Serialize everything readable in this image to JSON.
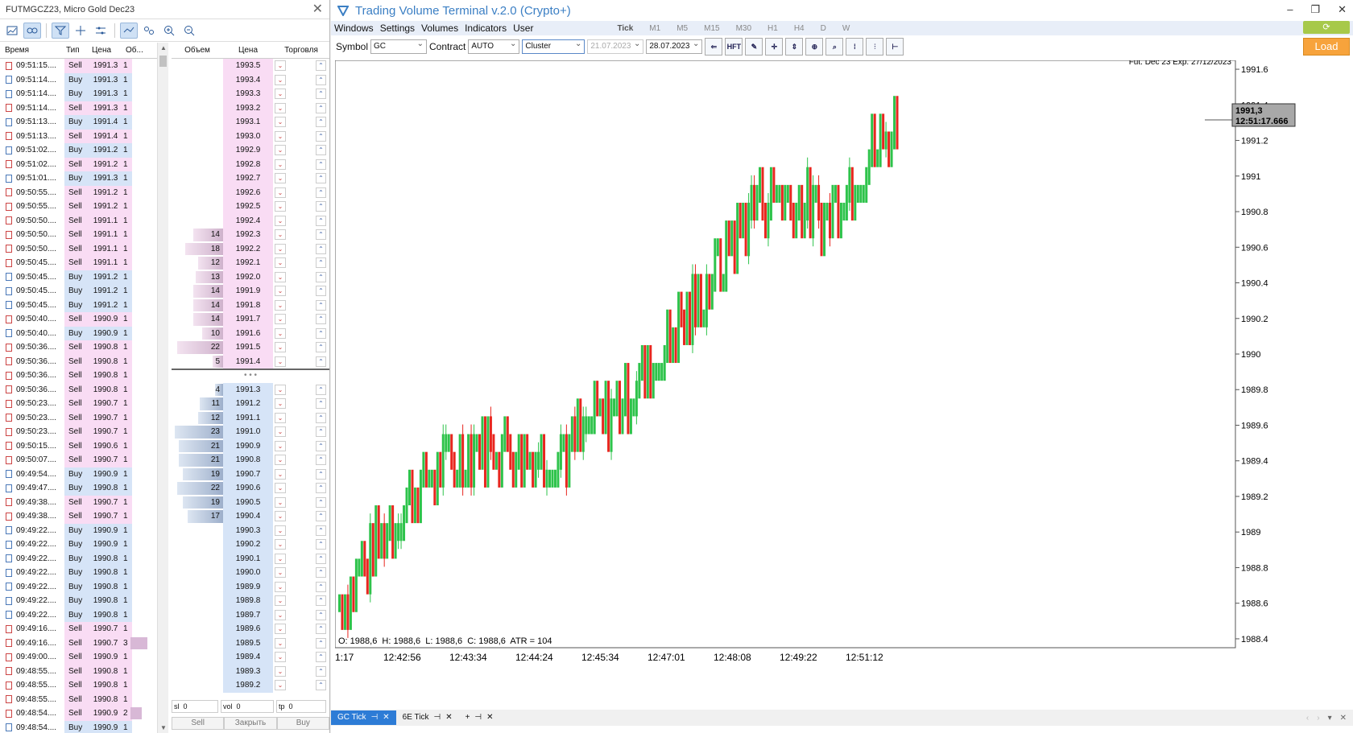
{
  "left_panel": {
    "title": "FUTMGCZ23, Micro Gold Dec23",
    "trade_headers": [
      "Время",
      "Тип",
      "Цена",
      "Об..."
    ],
    "trades": [
      {
        "time": "09:51:15....",
        "type": "Sell",
        "price": "1991.3",
        "vol": "1"
      },
      {
        "time": "09:51:14....",
        "type": "Buy",
        "price": "1991.3",
        "vol": "1"
      },
      {
        "time": "09:51:14....",
        "type": "Buy",
        "price": "1991.3",
        "vol": "1"
      },
      {
        "time": "09:51:14....",
        "type": "Sell",
        "price": "1991.3",
        "vol": "1"
      },
      {
        "time": "09:51:13....",
        "type": "Buy",
        "price": "1991.4",
        "vol": "1"
      },
      {
        "time": "09:51:13....",
        "type": "Sell",
        "price": "1991.4",
        "vol": "1"
      },
      {
        "time": "09:51:02....",
        "type": "Buy",
        "price": "1991.2",
        "vol": "1"
      },
      {
        "time": "09:51:02....",
        "type": "Sell",
        "price": "1991.2",
        "vol": "1"
      },
      {
        "time": "09:51:01....",
        "type": "Buy",
        "price": "1991.3",
        "vol": "1"
      },
      {
        "time": "09:50:55....",
        "type": "Sell",
        "price": "1991.2",
        "vol": "1"
      },
      {
        "time": "09:50:55....",
        "type": "Sell",
        "price": "1991.2",
        "vol": "1"
      },
      {
        "time": "09:50:50....",
        "type": "Sell",
        "price": "1991.1",
        "vol": "1"
      },
      {
        "time": "09:50:50....",
        "type": "Sell",
        "price": "1991.1",
        "vol": "1"
      },
      {
        "time": "09:50:50....",
        "type": "Sell",
        "price": "1991.1",
        "vol": "1"
      },
      {
        "time": "09:50:45....",
        "type": "Sell",
        "price": "1991.1",
        "vol": "1"
      },
      {
        "time": "09:50:45....",
        "type": "Buy",
        "price": "1991.2",
        "vol": "1"
      },
      {
        "time": "09:50:45....",
        "type": "Buy",
        "price": "1991.2",
        "vol": "1"
      },
      {
        "time": "09:50:45....",
        "type": "Buy",
        "price": "1991.2",
        "vol": "1"
      },
      {
        "time": "09:50:40....",
        "type": "Sell",
        "price": "1990.9",
        "vol": "1"
      },
      {
        "time": "09:50:40....",
        "type": "Buy",
        "price": "1990.9",
        "vol": "1"
      },
      {
        "time": "09:50:36....",
        "type": "Sell",
        "price": "1990.8",
        "vol": "1"
      },
      {
        "time": "09:50:36....",
        "type": "Sell",
        "price": "1990.8",
        "vol": "1"
      },
      {
        "time": "09:50:36....",
        "type": "Sell",
        "price": "1990.8",
        "vol": "1"
      },
      {
        "time": "09:50:36....",
        "type": "Sell",
        "price": "1990.8",
        "vol": "1"
      },
      {
        "time": "09:50:23....",
        "type": "Sell",
        "price": "1990.7",
        "vol": "1"
      },
      {
        "time": "09:50:23....",
        "type": "Sell",
        "price": "1990.7",
        "vol": "1"
      },
      {
        "time": "09:50:23....",
        "type": "Sell",
        "price": "1990.7",
        "vol": "1"
      },
      {
        "time": "09:50:15....",
        "type": "Sell",
        "price": "1990.6",
        "vol": "1"
      },
      {
        "time": "09:50:07....",
        "type": "Sell",
        "price": "1990.7",
        "vol": "1"
      },
      {
        "time": "09:49:54....",
        "type": "Buy",
        "price": "1990.9",
        "vol": "1"
      },
      {
        "time": "09:49:47....",
        "type": "Buy",
        "price": "1990.8",
        "vol": "1"
      },
      {
        "time": "09:49:38....",
        "type": "Sell",
        "price": "1990.7",
        "vol": "1"
      },
      {
        "time": "09:49:38....",
        "type": "Sell",
        "price": "1990.7",
        "vol": "1"
      },
      {
        "time": "09:49:22....",
        "type": "Buy",
        "price": "1990.9",
        "vol": "1"
      },
      {
        "time": "09:49:22....",
        "type": "Buy",
        "price": "1990.9",
        "vol": "1"
      },
      {
        "time": "09:49:22....",
        "type": "Buy",
        "price": "1990.8",
        "vol": "1"
      },
      {
        "time": "09:49:22....",
        "type": "Buy",
        "price": "1990.8",
        "vol": "1"
      },
      {
        "time": "09:49:22....",
        "type": "Buy",
        "price": "1990.8",
        "vol": "1"
      },
      {
        "time": "09:49:22....",
        "type": "Buy",
        "price": "1990.8",
        "vol": "1"
      },
      {
        "time": "09:49:22....",
        "type": "Buy",
        "price": "1990.8",
        "vol": "1"
      },
      {
        "time": "09:49:16....",
        "type": "Sell",
        "price": "1990.7",
        "vol": "1"
      },
      {
        "time": "09:49:16....",
        "type": "Sell",
        "price": "1990.7",
        "vol": "3"
      },
      {
        "time": "09:49:00....",
        "type": "Sell",
        "price": "1990.9",
        "vol": "1"
      },
      {
        "time": "09:48:55....",
        "type": "Sell",
        "price": "1990.8",
        "vol": "1"
      },
      {
        "time": "09:48:55....",
        "type": "Sell",
        "price": "1990.8",
        "vol": "1"
      },
      {
        "time": "09:48:55....",
        "type": "Sell",
        "price": "1990.8",
        "vol": "1"
      },
      {
        "time": "09:48:54....",
        "type": "Sell",
        "price": "1990.9",
        "vol": "2"
      },
      {
        "time": "09:48:54....",
        "type": "Buy",
        "price": "1990.9",
        "vol": "1"
      }
    ],
    "dom_headers": [
      "Объем",
      "Цена",
      "Торговля"
    ],
    "asks": [
      {
        "price": "1993.5",
        "vol": ""
      },
      {
        "price": "1993.4",
        "vol": ""
      },
      {
        "price": "1993.3",
        "vol": ""
      },
      {
        "price": "1993.2",
        "vol": ""
      },
      {
        "price": "1993.1",
        "vol": ""
      },
      {
        "price": "1993.0",
        "vol": ""
      },
      {
        "price": "1992.9",
        "vol": ""
      },
      {
        "price": "1992.8",
        "vol": ""
      },
      {
        "price": "1992.7",
        "vol": ""
      },
      {
        "price": "1992.6",
        "vol": ""
      },
      {
        "price": "1992.5",
        "vol": ""
      },
      {
        "price": "1992.4",
        "vol": ""
      },
      {
        "price": "1992.3",
        "vol": "14"
      },
      {
        "price": "1992.2",
        "vol": "18"
      },
      {
        "price": "1992.1",
        "vol": "12"
      },
      {
        "price": "1992.0",
        "vol": "13"
      },
      {
        "price": "1991.9",
        "vol": "14"
      },
      {
        "price": "1991.8",
        "vol": "14"
      },
      {
        "price": "1991.7",
        "vol": "14"
      },
      {
        "price": "1991.6",
        "vol": "10"
      },
      {
        "price": "1991.5",
        "vol": "22"
      },
      {
        "price": "1991.4",
        "vol": "5"
      }
    ],
    "bids": [
      {
        "price": "1991.3",
        "vol": "4"
      },
      {
        "price": "1991.2",
        "vol": "11"
      },
      {
        "price": "1991.1",
        "vol": "12"
      },
      {
        "price": "1991.0",
        "vol": "23"
      },
      {
        "price": "1990.9",
        "vol": "21"
      },
      {
        "price": "1990.8",
        "vol": "21"
      },
      {
        "price": "1990.7",
        "vol": "19"
      },
      {
        "price": "1990.6",
        "vol": "22"
      },
      {
        "price": "1990.5",
        "vol": "19"
      },
      {
        "price": "1990.4",
        "vol": "17"
      },
      {
        "price": "1990.3",
        "vol": ""
      },
      {
        "price": "1990.2",
        "vol": ""
      },
      {
        "price": "1990.1",
        "vol": ""
      },
      {
        "price": "1990.0",
        "vol": ""
      },
      {
        "price": "1989.9",
        "vol": ""
      },
      {
        "price": "1989.8",
        "vol": ""
      },
      {
        "price": "1989.7",
        "vol": ""
      },
      {
        "price": "1989.6",
        "vol": ""
      },
      {
        "price": "1989.5",
        "vol": ""
      },
      {
        "price": "1989.4",
        "vol": ""
      },
      {
        "price": "1989.3",
        "vol": ""
      },
      {
        "price": "1989.2",
        "vol": ""
      }
    ],
    "dom_sep": "• • •",
    "controls": {
      "sl_label": "sl",
      "sl_value": "0",
      "vol_label": "vol",
      "vol_value": "0",
      "tp_label": "tp",
      "tp_value": "0"
    },
    "actions": {
      "sell": "Sell",
      "close": "Закрыть",
      "buy": "Buy"
    }
  },
  "window": {
    "title": "Trading Volume Terminal v.2.0 (Crypto+)",
    "min": "–",
    "max": "❐",
    "close": "✕"
  },
  "menu": [
    "Windows",
    "Settings",
    "Volumes",
    "Indicators",
    "User"
  ],
  "timeframes": [
    "Tick",
    "M1",
    "M5",
    "M15",
    "M30",
    "H1",
    "H4",
    "D",
    "W"
  ],
  "toolbar": {
    "symbol_label": "Symbol",
    "symbol_value": "GC",
    "contract_label": "Contract",
    "contract_value": "AUTO",
    "chart_type": "Cluster",
    "date_from": "21.07.2023",
    "date_to": "28.07.2023",
    "hft_label": "HFT",
    "load": "Load"
  },
  "chart": {
    "contract_info": "Fut. Dec 23 Exp. 27/12/2023",
    "price_label_value": "1991,3",
    "price_label_time": "12:51:17.666",
    "ohlc": "O: 1988,6  H: 1988,6  L: 1988,6  C: 1988,6  ATR = 104",
    "y_ticks": [
      "1991.6",
      "1991.4",
      "1991.2",
      "1991",
      "1990.8",
      "1990.6",
      "1990.4",
      "1990.2",
      "1990",
      "1989.8",
      "1989.6",
      "1989.4",
      "1989.2",
      "1989",
      "1988.8",
      "1988.6",
      "1988.4"
    ],
    "x_ticks": [
      "1:17",
      "12:42:56",
      "12:43:34",
      "12:44:24",
      "12:45:34",
      "12:47:01",
      "12:48:08",
      "12:49:22",
      "12:51:12"
    ],
    "colors": {
      "up": "#2ec34b",
      "down": "#e8261f"
    }
  },
  "tabs": [
    {
      "label": "GC Tick",
      "selected": true
    },
    {
      "label": "6E Tick",
      "selected": false
    }
  ],
  "chart_data": {
    "type": "line",
    "title": "",
    "xlabel": "",
    "ylabel": "",
    "x": [
      "1:17",
      "12:42:56",
      "12:43:34",
      "12:44:24",
      "12:45:34",
      "12:47:01",
      "12:48:08",
      "12:49:22",
      "12:51:12"
    ],
    "series": [
      {
        "values": [
          1988.6,
          1989.2,
          1989.5,
          1989.4,
          1989.7,
          1990.2,
          1990.9,
          1990.8,
          1991.3
        ]
      }
    ],
    "ylim": [
      1988.35,
      1991.65
    ]
  }
}
